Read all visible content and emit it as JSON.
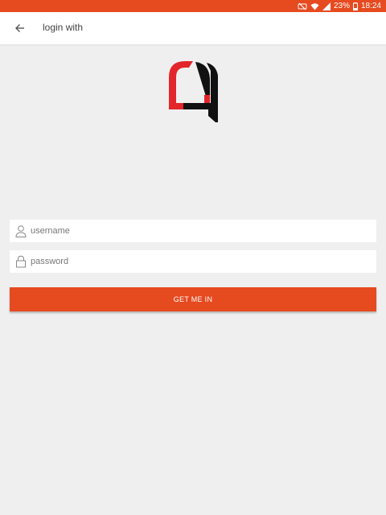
{
  "status_bar": {
    "battery": "23%",
    "time": "18:24",
    "icons": [
      "mute-icon",
      "wifi-icon",
      "signal-icon",
      "battery-icon"
    ]
  },
  "header": {
    "back_icon": "arrow-left-icon",
    "title": "login with"
  },
  "logo": {
    "icon": "app-logo",
    "colors": {
      "red": "#e2262b",
      "black": "#111111"
    }
  },
  "form": {
    "username": {
      "placeholder": "username",
      "value": "",
      "icon": "user-icon"
    },
    "password": {
      "placeholder": "password",
      "value": "",
      "icon": "lock-icon"
    },
    "submit_label": "GET ME IN"
  },
  "colors": {
    "accent": "#e64a1f",
    "background": "#efefef",
    "surface": "#ffffff"
  }
}
